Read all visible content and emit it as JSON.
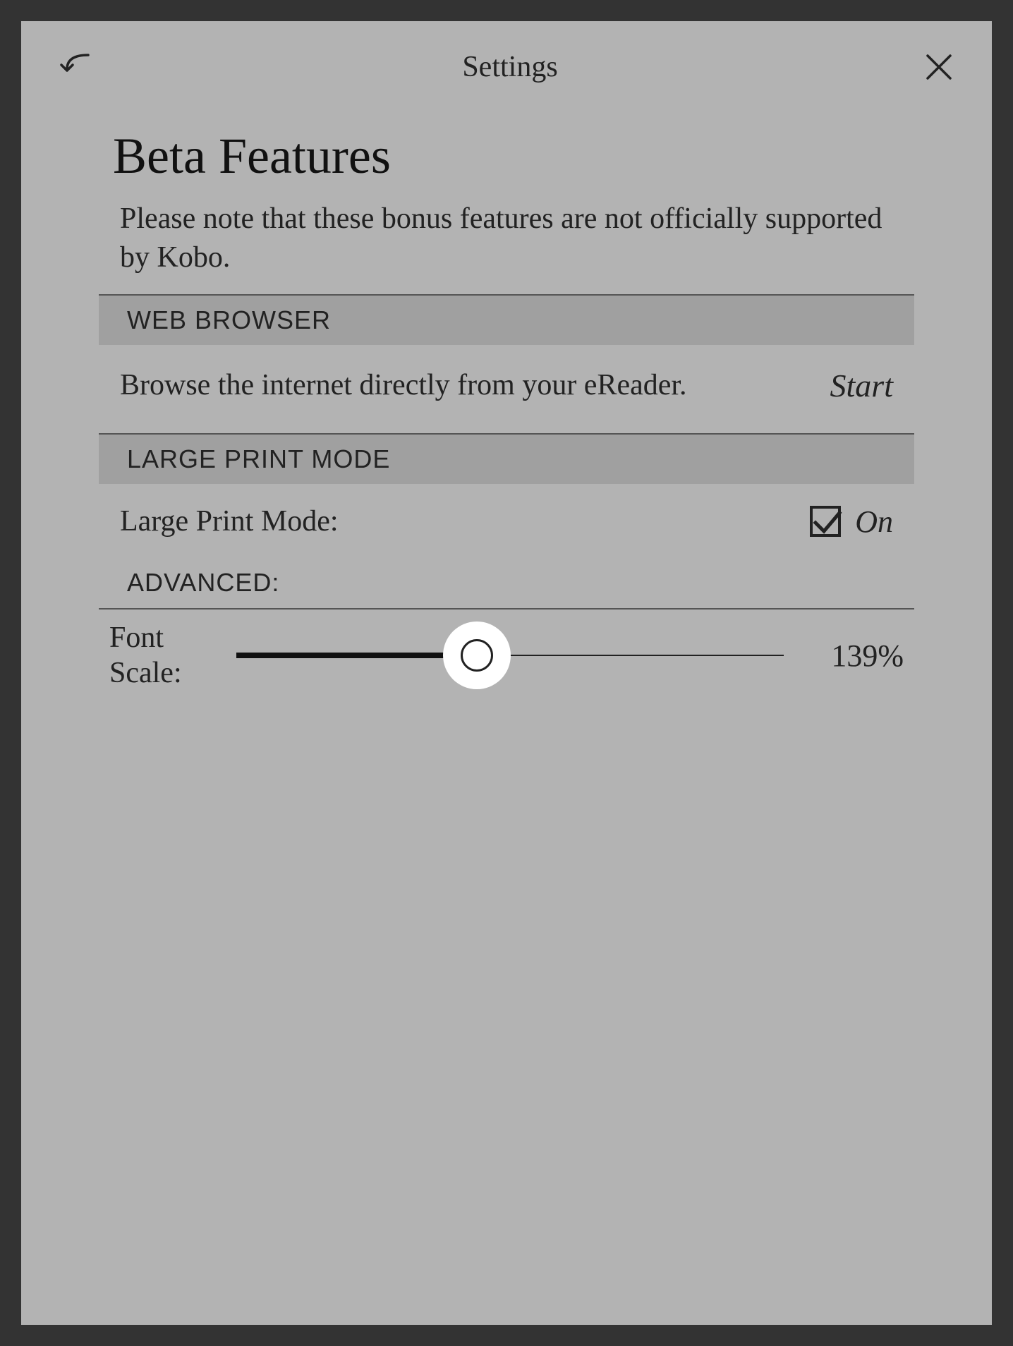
{
  "header": {
    "title": "Settings"
  },
  "page": {
    "title": "Beta Features",
    "subtitle": "Please note that these bonus features are not officially supported by Kobo."
  },
  "sections": {
    "web_browser": {
      "header": "WEB BROWSER",
      "desc": "Browse the internet directly from your eReader.",
      "action": "Start"
    },
    "large_print": {
      "header": "LARGE PRINT MODE",
      "label": "Large Print Mode:",
      "state": "On",
      "checked": true,
      "advanced_label": "ADVANCED:",
      "font_scale_label": "Font Scale:",
      "font_scale_value": "139%",
      "font_scale_percent": 44
    }
  }
}
